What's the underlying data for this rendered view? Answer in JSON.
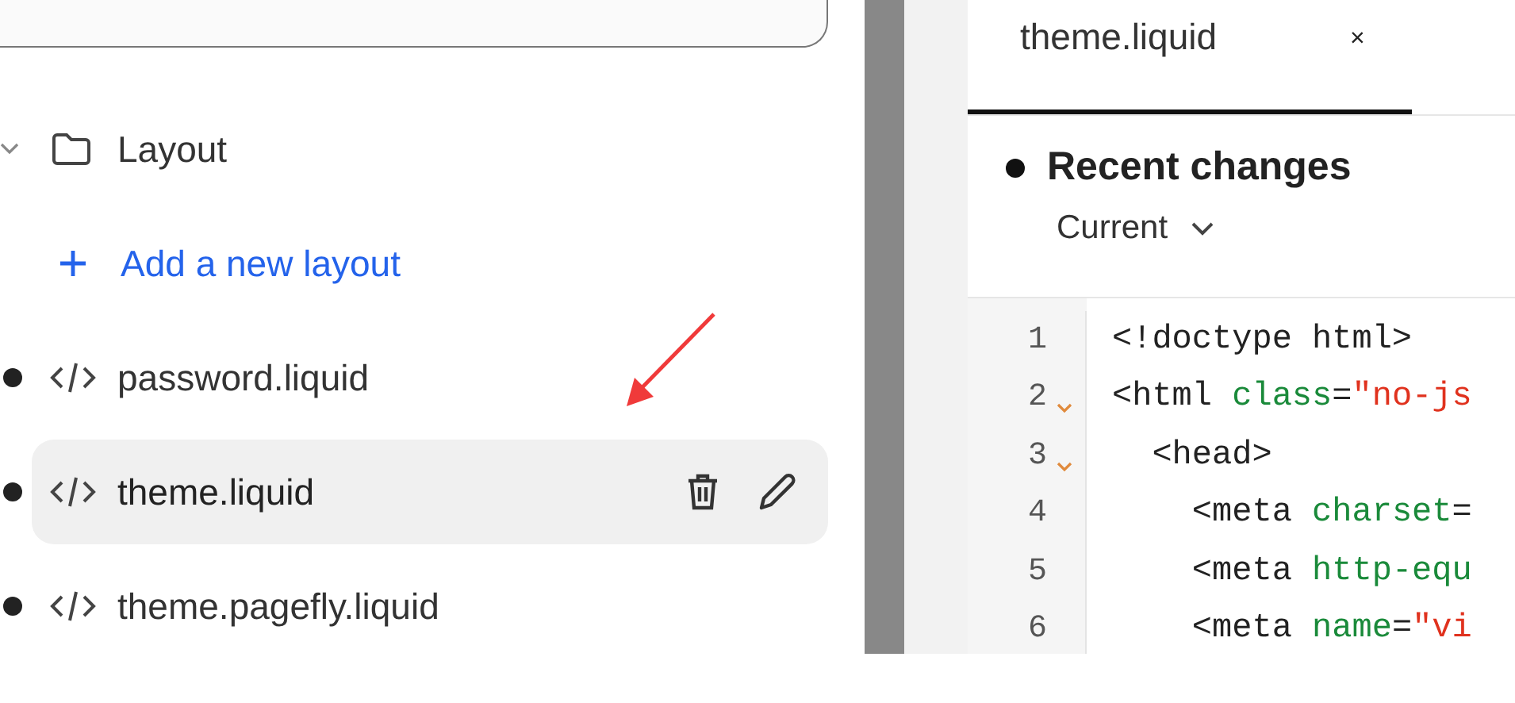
{
  "sidebar": {
    "folder": {
      "label": "Layout",
      "expanded": true,
      "add_label": "Add a new layout",
      "children": [
        {
          "name": "password.liquid",
          "selected": false
        },
        {
          "name": "theme.liquid",
          "selected": true
        },
        {
          "name": "theme.pagefly.liquid",
          "selected": false
        }
      ]
    }
  },
  "editor": {
    "tabs": [
      {
        "label": "theme.liquid",
        "close": "×",
        "selected": true
      }
    ],
    "recent_changes": {
      "title": "Recent changes",
      "version": "Current"
    },
    "lines": [
      {
        "number": "1",
        "foldable": false,
        "tokens": [
          {
            "kind": "tag",
            "text": "<!doctype html>"
          }
        ]
      },
      {
        "number": "2",
        "foldable": true,
        "tokens": [
          {
            "kind": "tag",
            "text": "<html "
          },
          {
            "kind": "attr",
            "text": "class"
          },
          {
            "kind": "tag",
            "text": "="
          },
          {
            "kind": "string",
            "text": "\"no-js"
          }
        ]
      },
      {
        "number": "3",
        "foldable": true,
        "tokens": [
          {
            "kind": "tag",
            "text": "  <head>"
          }
        ]
      },
      {
        "number": "4",
        "foldable": false,
        "tokens": [
          {
            "kind": "tag",
            "text": "    <meta "
          },
          {
            "kind": "attr",
            "text": "charset"
          },
          {
            "kind": "tag",
            "text": "="
          }
        ]
      },
      {
        "number": "5",
        "foldable": false,
        "tokens": [
          {
            "kind": "tag",
            "text": "    <meta "
          },
          {
            "kind": "attr",
            "text": "http-equ"
          }
        ]
      },
      {
        "number": "6",
        "foldable": false,
        "tokens": [
          {
            "kind": "tag",
            "text": "    <meta "
          },
          {
            "kind": "attr",
            "text": "name"
          },
          {
            "kind": "tag",
            "text": "="
          },
          {
            "kind": "string",
            "text": "\"vi"
          }
        ]
      }
    ]
  }
}
